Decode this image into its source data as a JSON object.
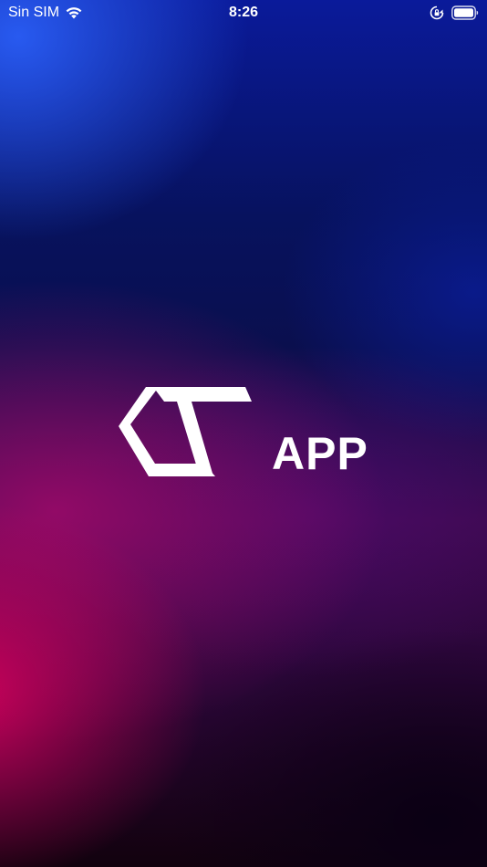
{
  "status_bar": {
    "carrier": "Sin SIM",
    "time": "8:26",
    "icons": [
      "wifi-icon",
      "orientation-lock-icon",
      "battery-icon"
    ]
  },
  "splash": {
    "logo_text": "APP",
    "logo_mark": "ct-logo-mark"
  },
  "colors": {
    "text": "#ffffff",
    "top_blue": "#285af0",
    "deep_navy": "#07125e",
    "magenta": "#d6005c",
    "dark_bottom": "#12020e"
  }
}
